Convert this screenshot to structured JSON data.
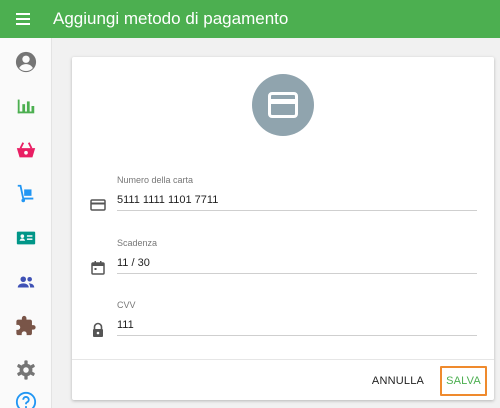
{
  "appbar": {
    "title": "Aggiungi metodo di pagamento",
    "background": "#4caf50",
    "menu_icon": "menu-icon"
  },
  "rail": {
    "items": [
      {
        "icon": "account-circle-icon",
        "color": "#757575"
      },
      {
        "icon": "bar-chart-icon",
        "color": "#4caf50"
      },
      {
        "icon": "basket-icon",
        "color": "#e91e63"
      },
      {
        "icon": "hand-truck-icon",
        "color": "#2196f3"
      },
      {
        "icon": "id-card-icon",
        "color": "#009688"
      },
      {
        "icon": "people-icon",
        "color": "#3f51b5"
      },
      {
        "icon": "puzzle-icon",
        "color": "#795548"
      },
      {
        "icon": "settings-icon",
        "color": "#757575"
      },
      {
        "icon": "help-icon",
        "color": "#2196f3"
      }
    ]
  },
  "card": {
    "avatar_icon": "credit-card-icon",
    "avatar_color": "#90a4ae",
    "fields": [
      {
        "label": "Numero della carta",
        "value": "5111 1111 1101 7711",
        "icon": "credit-card-icon"
      },
      {
        "label": "Scadenza",
        "value": "11 / 30",
        "icon": "calendar-icon"
      },
      {
        "label": "CVV",
        "value": "111",
        "icon": "lock-icon"
      }
    ],
    "actions": {
      "cancel_label": "ANNULLA",
      "save_label": "SALVA",
      "save_color": "#4caf50",
      "highlight_color": "#ef8a2d"
    }
  }
}
